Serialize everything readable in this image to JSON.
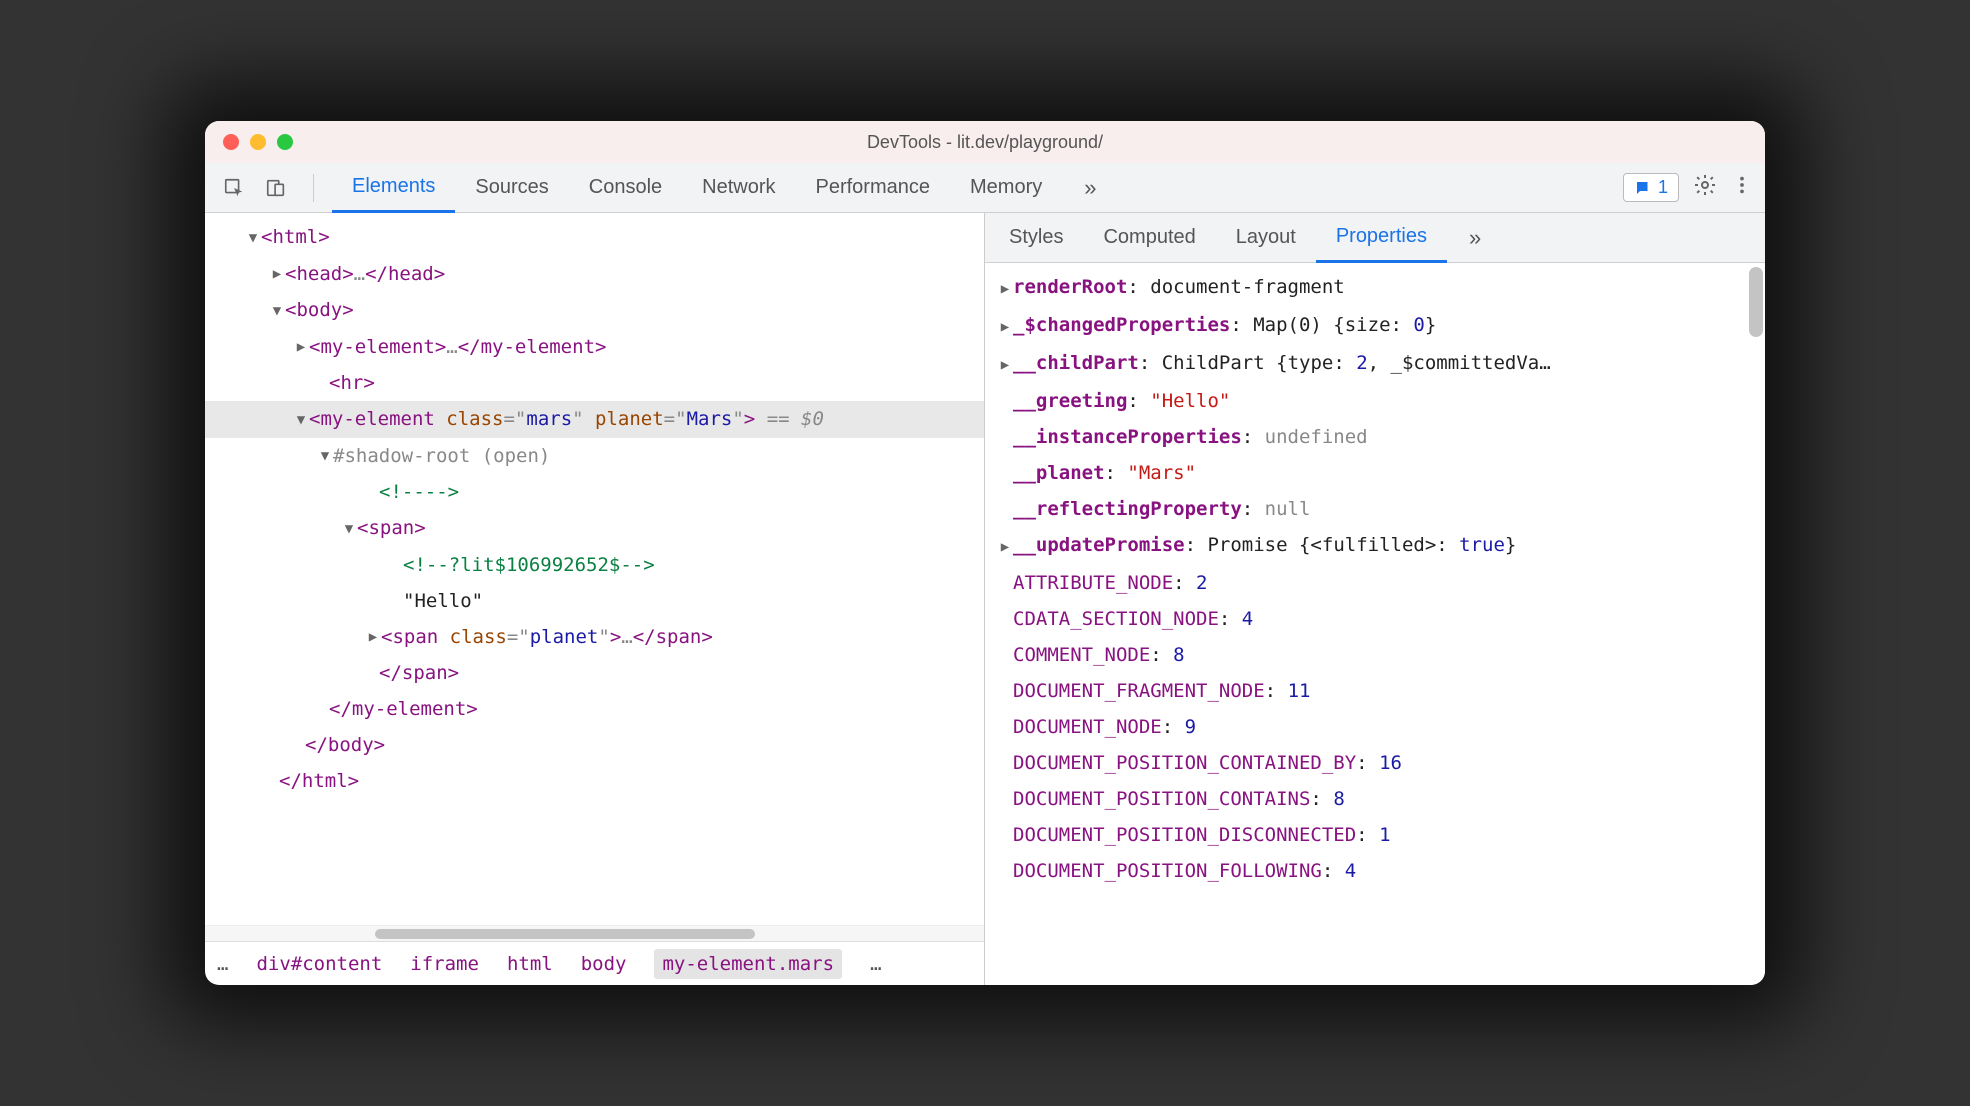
{
  "window": {
    "title": "DevTools - lit.dev/playground/"
  },
  "toolbar": {
    "tabs": [
      "Elements",
      "Sources",
      "Console",
      "Network",
      "Performance",
      "Memory"
    ],
    "activeTab": "Elements",
    "issuesCount": "1"
  },
  "dom": {
    "lines": [
      {
        "indent": 40,
        "toggle": "▼",
        "html": "<span class='tag'>&lt;html&gt;</span>"
      },
      {
        "indent": 64,
        "toggle": "▶",
        "html": "<span class='tag'>&lt;head&gt;</span><span class='gray'>…</span><span class='tag'>&lt;/head&gt;</span>"
      },
      {
        "indent": 64,
        "toggle": "▼",
        "html": "<span class='tag'>&lt;body&gt;</span>"
      },
      {
        "indent": 88,
        "toggle": "▶",
        "html": "<span class='tag'>&lt;my-element&gt;</span><span class='gray'>…</span><span class='tag'>&lt;/my-element&gt;</span>"
      },
      {
        "indent": 108,
        "toggle": "",
        "html": "<span class='tag'>&lt;hr&gt;</span>"
      },
      {
        "indent": 88,
        "toggle": "▼",
        "selected": true,
        "html": "<span class='tag'>&lt;my-element </span><span class='attr'>class</span><span class='gray'>=\"</span><span class='val'>mars</span><span class='gray'>\" </span><span class='attr'>planet</span><span class='gray'>=\"</span><span class='val'>Mars</span><span class='gray'>\"</span><span class='tag'>&gt;</span> <span class='eqd0'>== $0</span>"
      },
      {
        "indent": 112,
        "toggle": "▼",
        "html": "<span class='gray'>#shadow-root (open)</span>"
      },
      {
        "indent": 158,
        "toggle": "",
        "html": "<span class='comment'>&lt;!----&gt;</span>"
      },
      {
        "indent": 136,
        "toggle": "▼",
        "html": "<span class='tag'>&lt;span&gt;</span>"
      },
      {
        "indent": 182,
        "toggle": "",
        "html": "<span class='comment'>&lt;!--?lit$106992652$--&gt;</span>"
      },
      {
        "indent": 182,
        "toggle": "",
        "html": "<span class='txt'>\"Hello\"</span>"
      },
      {
        "indent": 160,
        "toggle": "▶",
        "html": "<span class='tag'>&lt;span </span><span class='attr'>class</span><span class='gray'>=\"</span><span class='val'>planet</span><span class='gray'>\"</span><span class='tag'>&gt;</span><span class='gray'>…</span><span class='tag'>&lt;/span&gt;</span>"
      },
      {
        "indent": 158,
        "toggle": "",
        "html": "<span class='tag'>&lt;/span&gt;</span>"
      },
      {
        "indent": 108,
        "toggle": "",
        "html": "<span class='tag'>&lt;/my-element&gt;</span>"
      },
      {
        "indent": 84,
        "toggle": "",
        "html": "<span class='tag'>&lt;/body&gt;</span>"
      },
      {
        "indent": 58,
        "toggle": "",
        "html": "<span class='tag'>&lt;/html&gt;</span>"
      }
    ]
  },
  "breadcrumbs": {
    "items": [
      "div#content",
      "iframe",
      "html",
      "body",
      "my-element.mars"
    ],
    "selected": "my-element.mars"
  },
  "rightTabs": {
    "tabs": [
      "Styles",
      "Computed",
      "Layout",
      "Properties"
    ],
    "active": "Properties"
  },
  "properties": [
    {
      "toggle": "▶",
      "name": "renderRoot",
      "bold": true,
      "value": "document-fragment",
      "valClass": "obj"
    },
    {
      "toggle": "▶",
      "name": "_$changedProperties",
      "bold": true,
      "value": "Map(0) {size: <span class='prop-val-num'>0</span>}",
      "valClass": "obj"
    },
    {
      "toggle": "▶",
      "name": "__childPart",
      "bold": true,
      "value": "ChildPart {type: <span class='prop-val-num'>2</span>, _$committedVa…",
      "valClass": "obj"
    },
    {
      "toggle": "",
      "name": "__greeting",
      "bold": true,
      "value": "\"Hello\"",
      "valClass": "str"
    },
    {
      "toggle": "",
      "name": "__instanceProperties",
      "bold": true,
      "value": "undefined",
      "valClass": "kw"
    },
    {
      "toggle": "",
      "name": "__planet",
      "bold": true,
      "value": "\"Mars\"",
      "valClass": "str"
    },
    {
      "toggle": "",
      "name": "__reflectingProperty",
      "bold": true,
      "value": "null",
      "valClass": "kw"
    },
    {
      "toggle": "▶",
      "name": "__updatePromise",
      "bold": true,
      "value": "Promise {&lt;fulfilled&gt;: <span class='prop-val-num'>true</span>}",
      "valClass": "obj"
    },
    {
      "toggle": "",
      "name": "ATTRIBUTE_NODE",
      "bold": false,
      "value": "2",
      "valClass": "num"
    },
    {
      "toggle": "",
      "name": "CDATA_SECTION_NODE",
      "bold": false,
      "value": "4",
      "valClass": "num"
    },
    {
      "toggle": "",
      "name": "COMMENT_NODE",
      "bold": false,
      "value": "8",
      "valClass": "num"
    },
    {
      "toggle": "",
      "name": "DOCUMENT_FRAGMENT_NODE",
      "bold": false,
      "value": "11",
      "valClass": "num"
    },
    {
      "toggle": "",
      "name": "DOCUMENT_NODE",
      "bold": false,
      "value": "9",
      "valClass": "num"
    },
    {
      "toggle": "",
      "name": "DOCUMENT_POSITION_CONTAINED_BY",
      "bold": false,
      "value": "16",
      "valClass": "num"
    },
    {
      "toggle": "",
      "name": "DOCUMENT_POSITION_CONTAINS",
      "bold": false,
      "value": "8",
      "valClass": "num"
    },
    {
      "toggle": "",
      "name": "DOCUMENT_POSITION_DISCONNECTED",
      "bold": false,
      "value": "1",
      "valClass": "num"
    },
    {
      "toggle": "",
      "name": "DOCUMENT_POSITION_FOLLOWING",
      "bold": false,
      "value": "4",
      "valClass": "num"
    }
  ]
}
